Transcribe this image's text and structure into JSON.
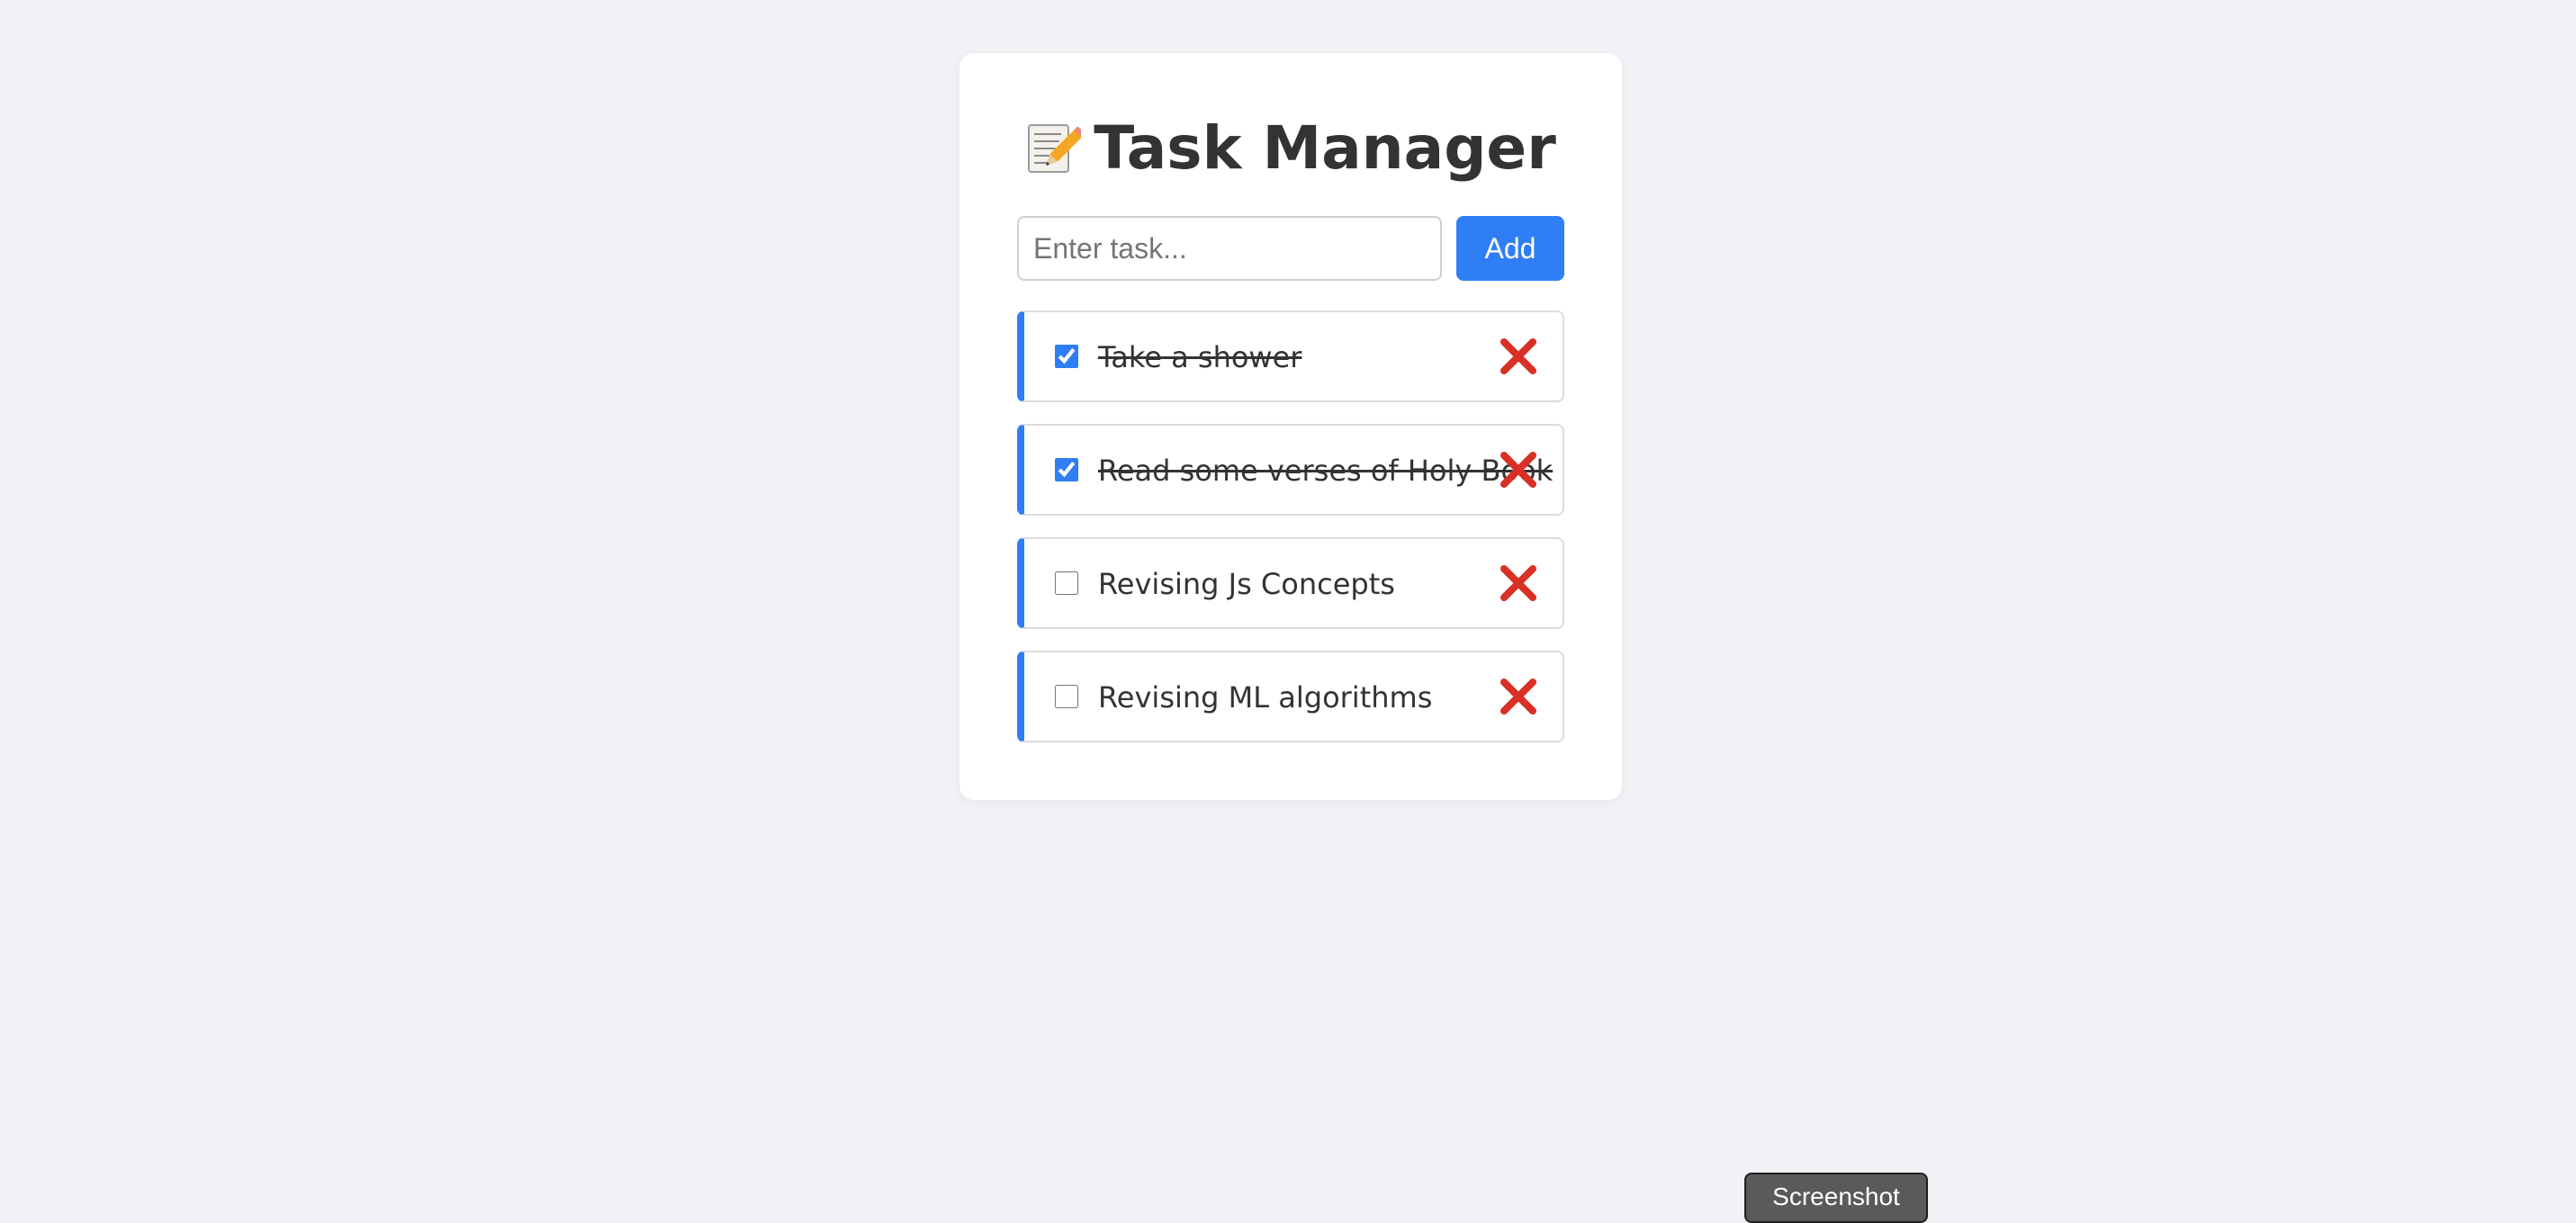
{
  "app": {
    "title": "Task Manager",
    "title_icon": "memo-icon"
  },
  "input": {
    "placeholder": "Enter task...",
    "value": ""
  },
  "add_button": {
    "label": "Add"
  },
  "tasks": [
    {
      "text": "Take a shower",
      "done": true
    },
    {
      "text": "Read some verses of Holy Book",
      "done": true
    },
    {
      "text": "Revising Js Concepts",
      "done": false
    },
    {
      "text": "Revising ML algorithms",
      "done": false
    }
  ],
  "delete_icon": "cross-mark-icon",
  "screenshot_button": {
    "label": "Screenshot"
  },
  "colors": {
    "background": "#f0f2f5",
    "card": "#ffffff",
    "accent": "#2f7ef5",
    "delete": "#d93025",
    "text": "#333333"
  }
}
